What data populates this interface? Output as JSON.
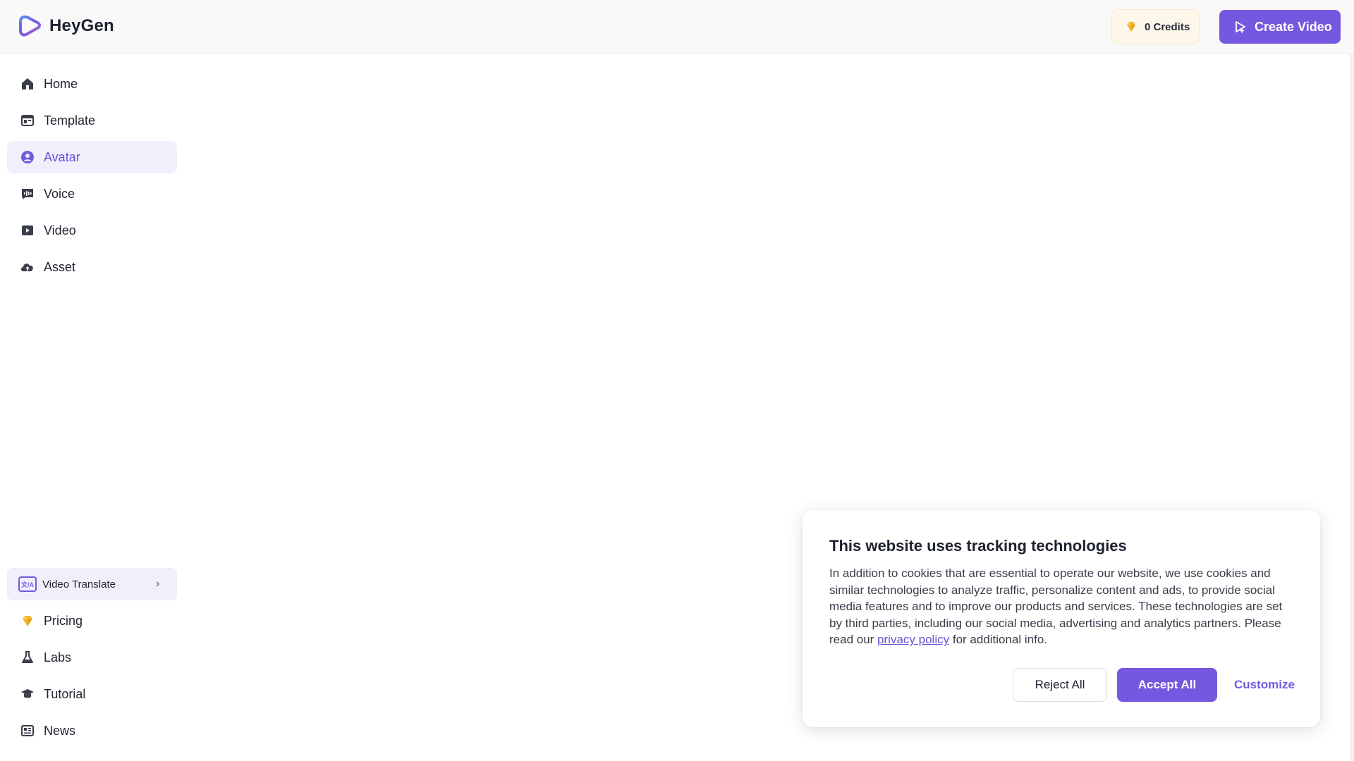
{
  "header": {
    "brand": "HeyGen",
    "credits_label": "0 Credits",
    "create_button_label": "Create Video"
  },
  "sidebar": {
    "items": [
      {
        "label": "Home",
        "icon": "home-icon"
      },
      {
        "label": "Template",
        "icon": "template-icon"
      },
      {
        "label": "Avatar",
        "icon": "avatar-icon",
        "active": true
      },
      {
        "label": "Voice",
        "icon": "voice-icon"
      },
      {
        "label": "Video",
        "icon": "video-icon"
      },
      {
        "label": "Asset",
        "icon": "cloud-upload-icon"
      }
    ],
    "bottom_items": [
      {
        "label": "Video Translate",
        "icon": "translate-icon"
      },
      {
        "label": "Pricing",
        "icon": "diamond-icon"
      },
      {
        "label": "Labs",
        "icon": "flask-icon"
      },
      {
        "label": "Tutorial",
        "icon": "graduation-cap-icon"
      },
      {
        "label": "News",
        "icon": "newspaper-icon"
      }
    ]
  },
  "cookie_banner": {
    "title": "This website uses tracking technologies",
    "body_text": "In addition to cookies that are essential to operate our website, we use cookies and similar technologies to analyze traffic, personalize content and ads, to provide social media features and to improve our products and services. These technologies are set by third parties, including our social media, advertising and analytics partners. Please read our",
    "link_text": "privacy policy",
    "body_suffix": "for additional info.",
    "reject_label": "Reject All",
    "accept_label": "Accept All",
    "customize_label": "Customize"
  },
  "colors": {
    "accent": "#7459e0",
    "active_bg": "#f1effc",
    "credits_bg": "#fdf7ea"
  }
}
